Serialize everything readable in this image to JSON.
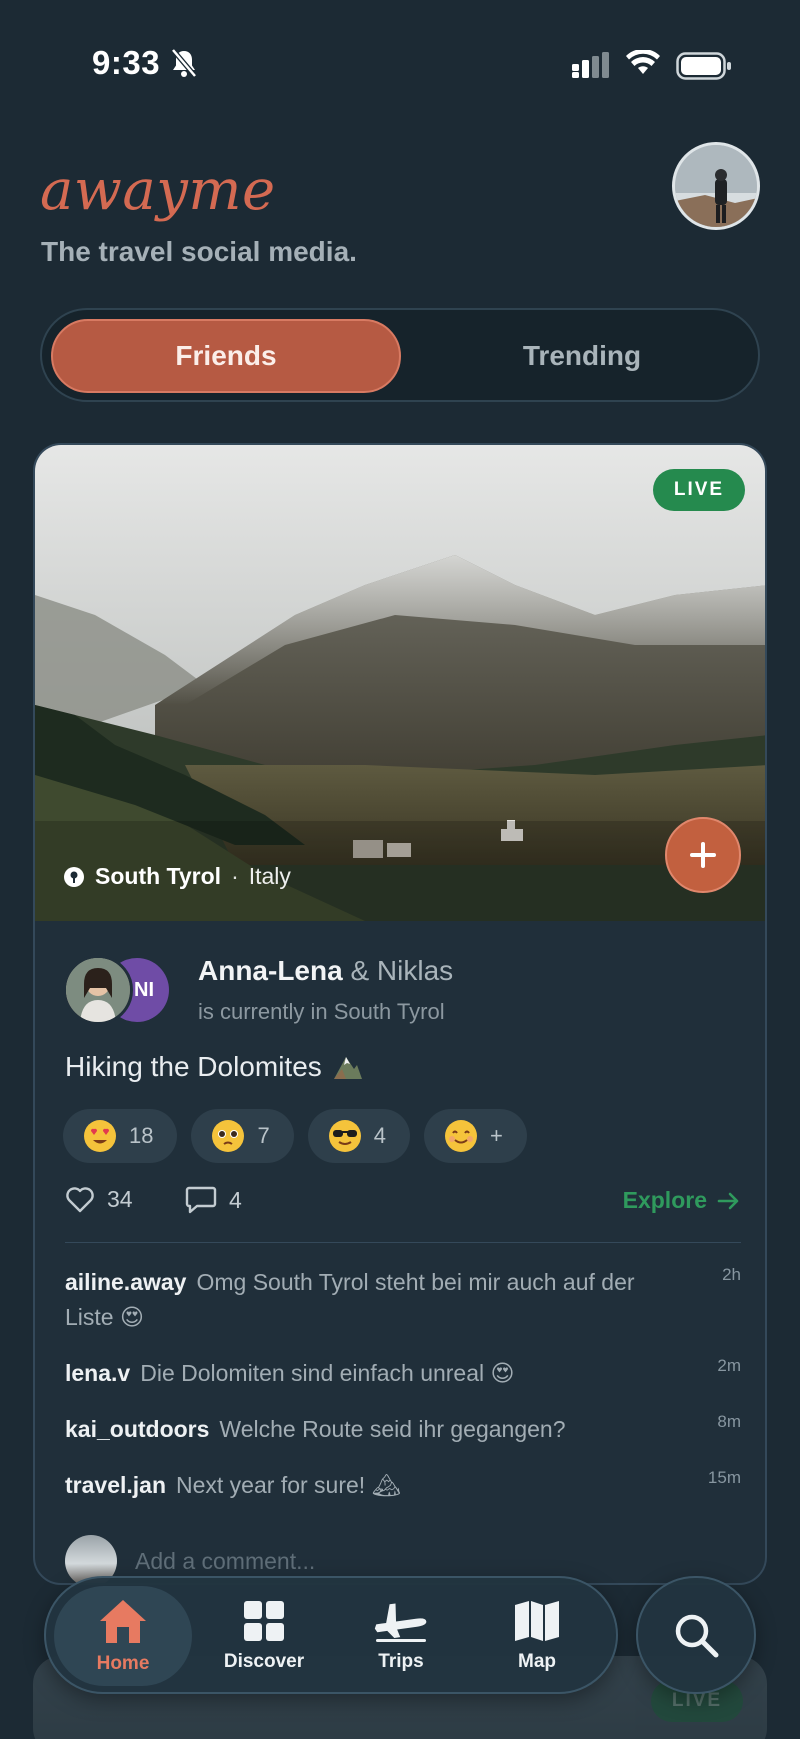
{
  "status_bar": {
    "time": "9:33"
  },
  "header": {
    "brand": "awayme",
    "tagline": "The travel social media."
  },
  "feed_toggle": {
    "friends_label": "Friends",
    "trending_label": "Trending",
    "selected": "Friends"
  },
  "post": {
    "live_label": "LIVE",
    "location_name": "South Tyrol",
    "location_separator": "·",
    "location_country": "Italy",
    "author_primary": "Anna-Lena",
    "author_secondary": "& Niklas",
    "second_avatar_initials": "NI",
    "status_line": "is currently in South Tyrol",
    "caption": "Hiking the Dolomites",
    "reactions": [
      {
        "emoji": "heart-eyes",
        "count": "18"
      },
      {
        "emoji": "pleading-face",
        "count": "7"
      },
      {
        "emoji": "sunglasses-face",
        "count": "4"
      },
      {
        "emoji": "smiling-face",
        "count": "+"
      }
    ],
    "likes": "34",
    "comments_count": "4",
    "explore_label": "Explore",
    "comments": [
      {
        "user": "ailine.away",
        "text": "Omg South Tyrol steht bei mir auch auf der Liste 😍",
        "time": "2h"
      },
      {
        "user": "lena.v",
        "text": "Die Dolomiten sind einfach unreal 😍",
        "time": "2m"
      },
      {
        "user": "kai_outdoors",
        "text": "Welche Route seid ihr gegangen?",
        "time": "8m"
      },
      {
        "user": "travel.jan",
        "text": "Next year for sure! 🏔",
        "time": "15m"
      }
    ],
    "comment_placeholder": "Add a comment..."
  },
  "next_post": {
    "live_label": "LIVE"
  },
  "tab_bar": {
    "items": [
      {
        "label": "Home",
        "icon": "home-icon",
        "active": true
      },
      {
        "label": "Discover",
        "icon": "grid-icon",
        "active": false
      },
      {
        "label": "Trips",
        "icon": "plane-icon",
        "active": false
      },
      {
        "label": "Map",
        "icon": "map-icon",
        "active": false
      }
    ],
    "search_icon": "search-icon"
  },
  "colors": {
    "background": "#1c2a34",
    "accent": "#b65a43",
    "brand": "#d46a52",
    "live_green": "#258a4e",
    "explore_green": "#2f9a5d"
  }
}
